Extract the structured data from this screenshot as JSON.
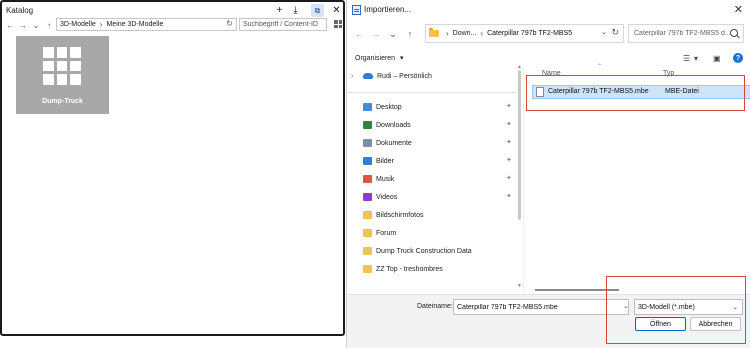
{
  "katalog": {
    "title": "Katalog",
    "breadcrumb": [
      "3D-Modelle",
      "Meine 3D-Modelle"
    ],
    "search_placeholder": "Suchbegriff / Content-ID",
    "tile_label": "Dump-Truck",
    "icons": [
      "add-icon",
      "download-icon",
      "open-external-icon",
      "close-icon",
      "back-icon",
      "forward-icon",
      "dropdown-icon",
      "up-icon",
      "refresh-icon",
      "grid-view-icon"
    ]
  },
  "dialog": {
    "title": "Importieren...",
    "address": {
      "first_crumb": "Down...",
      "current": "Caterpillar 797b TF2-MBS5"
    },
    "search_placeholder": "Caterpillar 797b TF2-MBS5 d...",
    "organize_label": "Organisieren",
    "help_label": "?",
    "nav": {
      "cloud_label": "Rudi – Persönlich",
      "quick_access": [
        {
          "label": "Desktop",
          "icon": "desktop-icon",
          "color": "#3a8fd8",
          "pinned": true
        },
        {
          "label": "Downloads",
          "icon": "download-icon",
          "color": "#2a8a3a",
          "pinned": true
        },
        {
          "label": "Dokumente",
          "icon": "documents-icon",
          "color": "#7d8fa8",
          "pinned": true
        },
        {
          "label": "Bilder",
          "icon": "pictures-icon",
          "color": "#2d7fd6",
          "pinned": true
        },
        {
          "label": "Musik",
          "icon": "music-icon",
          "color": "#e0573c",
          "pinned": true
        },
        {
          "label": "Videos",
          "icon": "videos-icon",
          "color": "#8a3ed0",
          "pinned": true
        },
        {
          "label": "Bildschirmfotos",
          "icon": "folder-icon",
          "color": "#f2c14e",
          "pinned": false
        },
        {
          "label": "Forum",
          "icon": "folder-icon",
          "color": "#f2c14e",
          "pinned": false
        },
        {
          "label": "Dump Truck Construction Data",
          "icon": "folder-icon",
          "color": "#f2c14e",
          "pinned": false
        },
        {
          "label": "ZZ Top - treshombres",
          "icon": "folder-icon",
          "color": "#f2c14e",
          "pinned": false
        }
      ]
    },
    "columns": {
      "name": "Name",
      "type": "Typ"
    },
    "files": [
      {
        "name": "Caterpillar 797b TF2-MBS5.mbe",
        "type": "MBE-Datei"
      }
    ],
    "filename_label": "Dateiname:",
    "filename_value": "Caterpillar 797b TF2-MBS5.mbe",
    "filetype_value": "3D-Modell (*.mbe)",
    "open_button": "Öffnen",
    "cancel_button": "Abbrechen"
  },
  "annotation_color": "#d9453d"
}
